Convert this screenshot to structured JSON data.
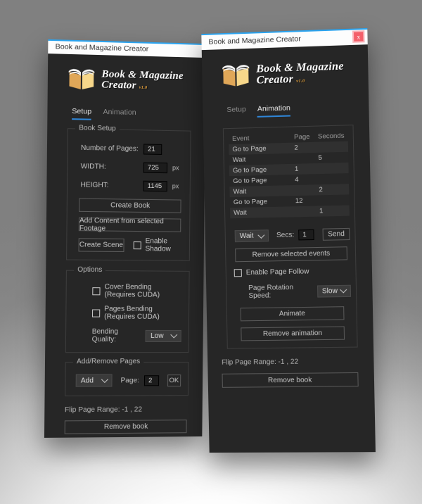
{
  "app": {
    "window_title": "Book and Magazine Creator",
    "logo_line1": "Book & Magazine",
    "logo_line2": "Creator",
    "logo_version": "v1.0",
    "close_label": "x",
    "accent_blue": "#2f86d8",
    "close_red": "#f4606a",
    "panel_bg": "#262626",
    "logo_gold": "#e8a33d"
  },
  "tabs": {
    "setup": "Setup",
    "animation": "Animation"
  },
  "setup_window": {
    "active_tab": "Setup",
    "book_setup": {
      "legend": "Book Setup",
      "pages_label": "Number of Pages:",
      "pages_value": "21",
      "width_label": "WIDTH:",
      "width_value": "725",
      "width_unit": "px",
      "height_label": "HEIGHT:",
      "height_value": "1145",
      "height_unit": "px",
      "create_book": "Create Book",
      "add_content": "Add Content from selected Footage",
      "create_scene": "Create Scene",
      "enable_shadow": "Enable Shadow",
      "enable_shadow_checked": false
    },
    "options": {
      "legend": "Options",
      "cover_bending": "Cover Bending (Requires CUDA)",
      "cover_bending_checked": false,
      "pages_bending": "Pages Bending (Requires CUDA)",
      "pages_bending_checked": false,
      "bending_quality_label": "Bending Quality:",
      "bending_quality_value": "Low"
    },
    "add_remove": {
      "legend": "Add/Remove Pages",
      "action_value": "Add",
      "page_label": "Page:",
      "page_value": "2",
      "ok": "OK"
    },
    "flip_range": "Flip Page Range: -1 , 22",
    "remove_book": "Remove book"
  },
  "animation_window": {
    "active_tab": "Animation",
    "table": {
      "headers": [
        "Event",
        "Page",
        "Seconds"
      ],
      "rows": [
        {
          "event": "Go to Page",
          "page": "2",
          "seconds": ""
        },
        {
          "event": "Wait",
          "page": "",
          "seconds": "5"
        },
        {
          "event": "Go to Page",
          "page": "1",
          "seconds": ""
        },
        {
          "event": "Go to Page",
          "page": "4",
          "seconds": ""
        },
        {
          "event": "Wait",
          "page": "",
          "seconds": "2"
        },
        {
          "event": "Go to Page",
          "page": "12",
          "seconds": ""
        },
        {
          "event": "Wait",
          "page": "",
          "seconds": "1"
        }
      ]
    },
    "event_type_value": "Wait",
    "secs_label": "Secs:",
    "secs_value": "1",
    "send": "Send",
    "remove_selected_events": "Remove selected events",
    "enable_page_follow": "Enable Page Follow",
    "enable_page_follow_checked": false,
    "page_rotation_label": "Page Rotation Speed:",
    "page_rotation_value": "Slow",
    "animate": "Animate",
    "remove_animation": "Remove animation",
    "flip_range": "Flip Page Range: -1 , 22",
    "remove_book": "Remove book"
  }
}
